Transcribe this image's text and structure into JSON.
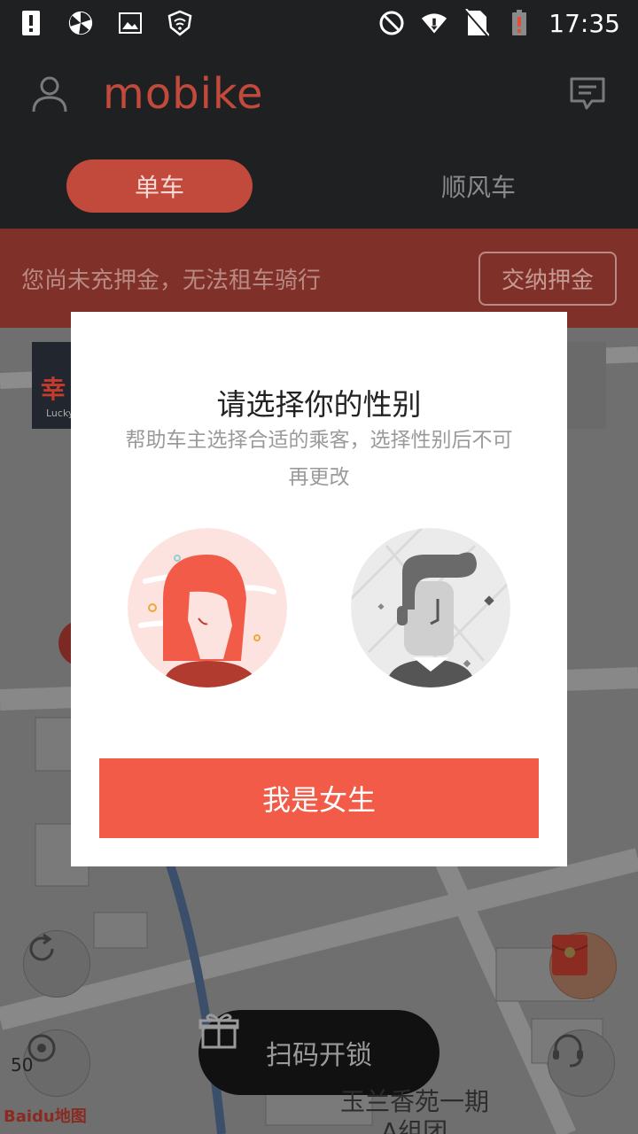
{
  "status_bar": {
    "time": "17:35",
    "icons": [
      "alert-icon",
      "pinwheel-icon",
      "image-icon",
      "shield-icon",
      "do-not-disturb-icon",
      "wifi-icon",
      "no-sim-icon",
      "battery-low-icon"
    ]
  },
  "app": {
    "logo": "mobike",
    "tabs": [
      {
        "label": "单车",
        "active": true
      },
      {
        "label": "顺风车",
        "active": false
      }
    ]
  },
  "banner": {
    "message": "您尚未充押金，无法租车骑行",
    "button": "交纳押金"
  },
  "map": {
    "scan_label": "扫码开锁",
    "place_label": "玉兰香苑一期",
    "place_label_2": "A组团",
    "scale_label": "50",
    "attribution": "Baidu地图",
    "ad_text": "幸",
    "ad_subtext": "Lucky"
  },
  "dialog": {
    "title": "请选择你的性别",
    "subtitle": "帮助车主选择合适的乘客，选择性别后不可再更改",
    "options": [
      {
        "id": "female",
        "icon": "female-avatar-icon",
        "selected": true
      },
      {
        "id": "male",
        "icon": "male-avatar-icon",
        "selected": false
      }
    ],
    "confirm": "我是女生"
  },
  "colors": {
    "brand_red": "#f15b48",
    "header_bg": "#1f2022",
    "tab_active": "#c24a3c"
  }
}
